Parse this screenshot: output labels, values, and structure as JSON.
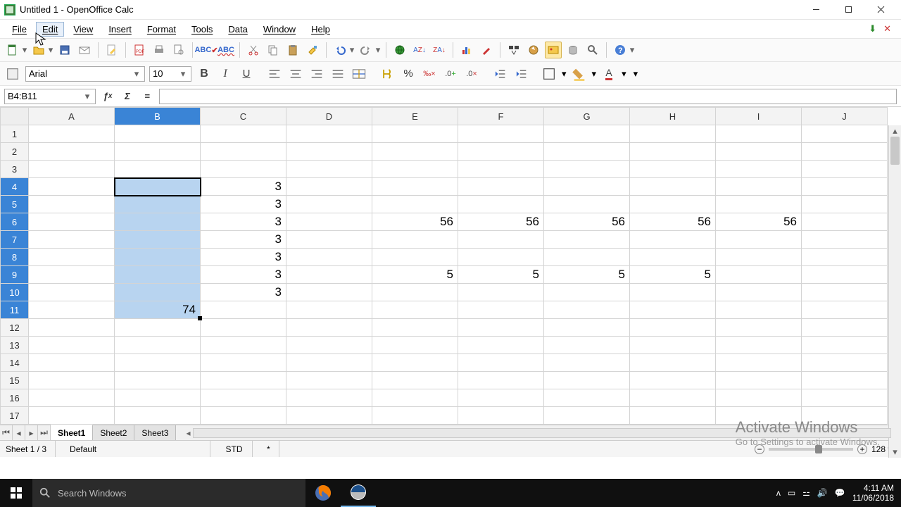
{
  "window": {
    "title": "Untitled 1 - OpenOffice Calc"
  },
  "menu": {
    "file": "File",
    "edit": "Edit",
    "view": "View",
    "insert": "Insert",
    "format": "Format",
    "tools": "Tools",
    "data": "Data",
    "window": "Window",
    "help": "Help"
  },
  "font": {
    "name": "Arial",
    "size": "10"
  },
  "cellref": {
    "value": "B4:B11"
  },
  "formula": {
    "value": ""
  },
  "columns": [
    "A",
    "B",
    "C",
    "D",
    "E",
    "F",
    "G",
    "H",
    "I",
    "J"
  ],
  "rows": [
    "1",
    "2",
    "3",
    "4",
    "5",
    "6",
    "7",
    "8",
    "9",
    "10",
    "11",
    "12",
    "13",
    "14",
    "15",
    "16",
    "17"
  ],
  "cells": {
    "B11": "74",
    "C4": "3",
    "C5": "3",
    "C6": "3",
    "C7": "3",
    "C8": "3",
    "C9": "3",
    "C10": "3",
    "E6": "56",
    "F6": "56",
    "G6": "56",
    "H6": "56",
    "I6": "56",
    "E9": "5",
    "F9": "5",
    "G9": "5",
    "H9": "5"
  },
  "selection": {
    "start": "B4",
    "end": "B11",
    "active": "B4"
  },
  "sheets": {
    "tabs": [
      "Sheet1",
      "Sheet2",
      "Sheet3"
    ],
    "active": 0
  },
  "status": {
    "sheet": "Sheet 1 / 3",
    "style": "Default",
    "mode": "STD",
    "modified": "*",
    "zoom": "128 %"
  },
  "watermark": {
    "line1": "Activate Windows",
    "line2": "Go to Settings to activate Windows."
  },
  "taskbar": {
    "search_placeholder": "Search Windows",
    "time": "4:11 AM",
    "date": "11/06/2018"
  }
}
